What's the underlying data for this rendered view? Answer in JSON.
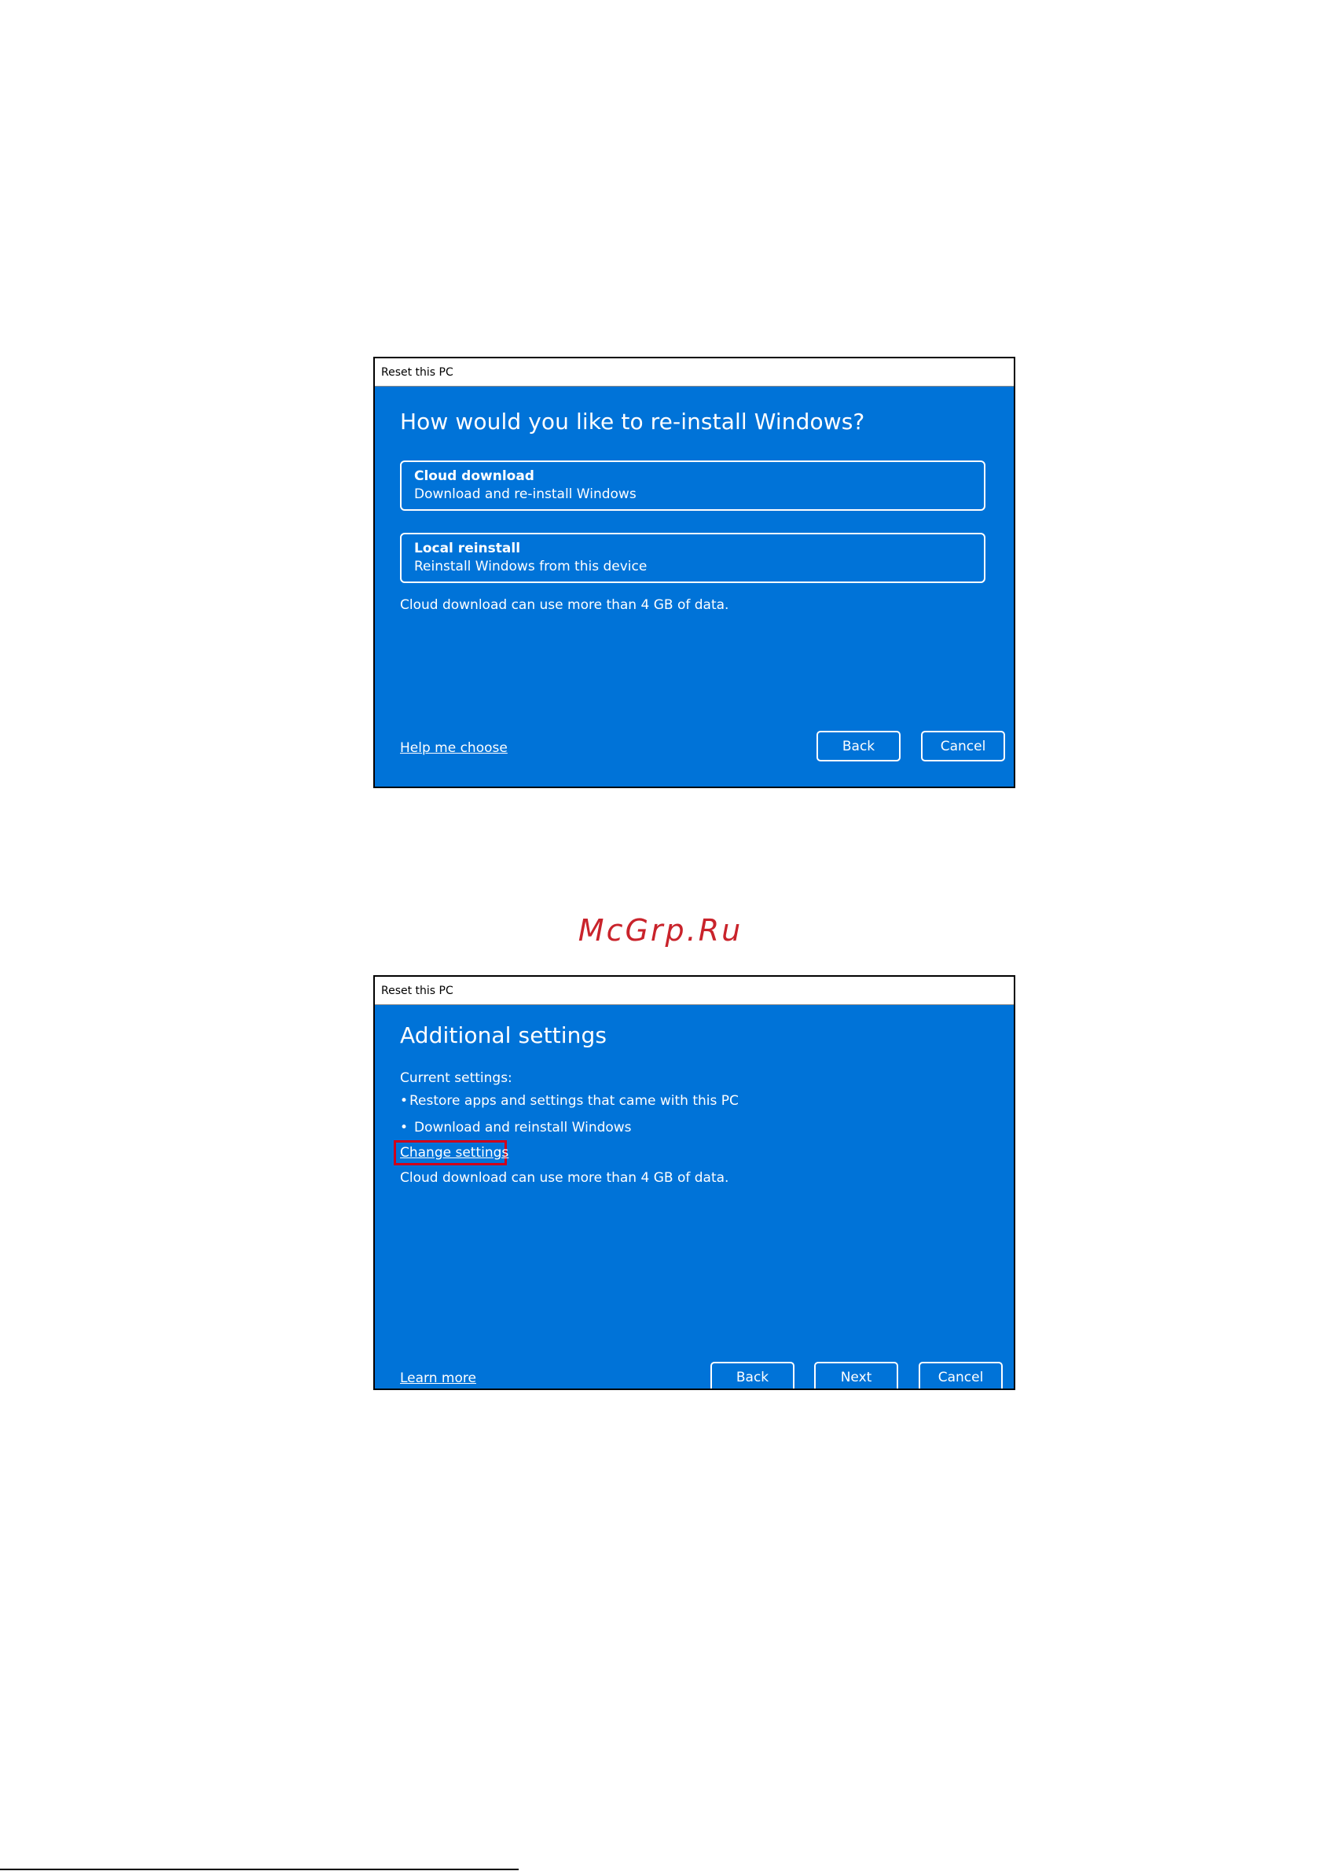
{
  "dialog_reinstall": {
    "window_title": "Reset this PC",
    "heading": "How would you like to re-install Windows?",
    "options": [
      {
        "title": "Cloud download",
        "description": "Download and re-install Windows"
      },
      {
        "title": "Local reinstall",
        "description": "Reinstall Windows from this device"
      }
    ],
    "note": "Cloud download can use more than 4 GB of data.",
    "help_link": "Help me choose",
    "back_label": "Back",
    "cancel_label": "Cancel"
  },
  "watermark": {
    "text": "McGrp.Ru",
    "color": "#c9232b"
  },
  "dialog_additional": {
    "window_title": "Reset this PC",
    "heading": "Additional settings",
    "current_settings_label": "Current settings:",
    "settings": [
      "Restore apps and settings that came with this PC",
      "Download and reinstall Windows"
    ],
    "bullet_glyph": "•",
    "change_settings_link": "Change settings",
    "note": "Cloud download can use more than 4 GB of data.",
    "learn_more_link": "Learn more",
    "back_label": "Back",
    "next_label": "Next",
    "cancel_label": "Cancel"
  },
  "colors": {
    "dialog_background": "#0073d8",
    "highlight": "#d0021b"
  }
}
